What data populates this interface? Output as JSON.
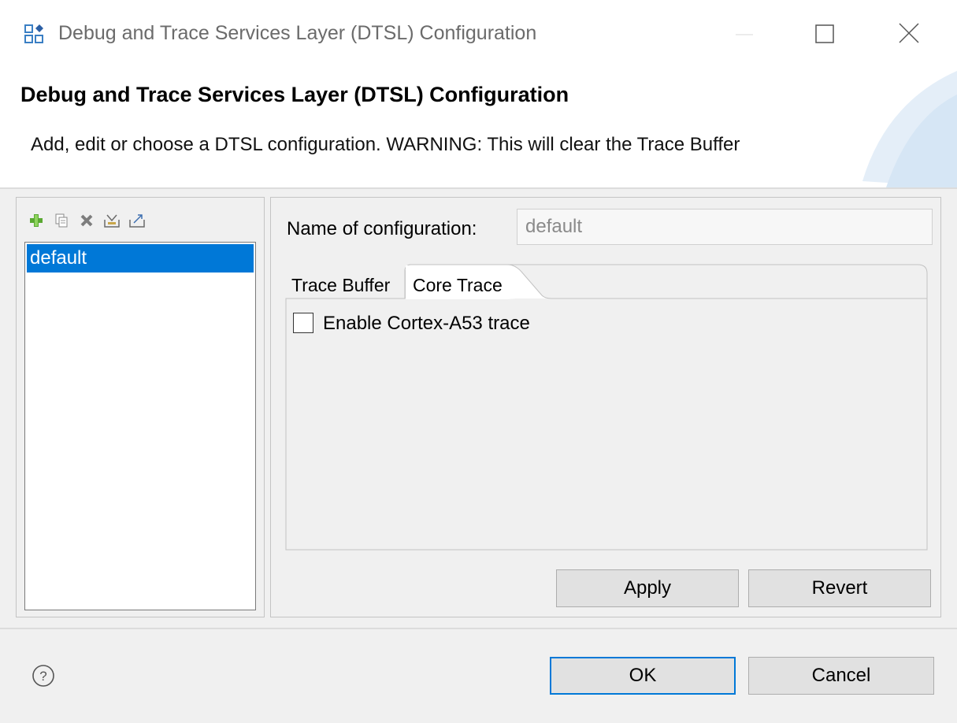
{
  "window": {
    "title": "Debug and Trace Services Layer (DTSL) Configuration",
    "icon": "dtsl-config-app-icon",
    "controls": [
      "minimize-icon",
      "maximize-icon",
      "close-icon"
    ]
  },
  "banner": {
    "title": "Debug and Trace Services Layer (DTSL) Configuration",
    "description": "Add, edit or choose a DTSL configuration.  WARNING: This will clear the Trace Buffer"
  },
  "toolbar": {
    "buttons": [
      {
        "icon": "add-icon"
      },
      {
        "icon": "copy-icon"
      },
      {
        "icon": "delete-icon"
      },
      {
        "icon": "import-icon"
      },
      {
        "icon": "export-icon"
      }
    ]
  },
  "config_list": {
    "items": [
      {
        "label": "default",
        "selected": true
      }
    ]
  },
  "config": {
    "name_label": "Name of configuration:",
    "name_value": "default"
  },
  "tabs": [
    {
      "label": "Trace Buffer",
      "active": false
    },
    {
      "label": "Core Trace",
      "active": true
    }
  ],
  "core_trace": {
    "enable_label": "Enable Cortex-A53 trace",
    "enabled": false
  },
  "buttons": {
    "apply": "Apply",
    "revert": "Revert",
    "ok": "OK",
    "cancel": "Cancel"
  },
  "colors": {
    "accent": "#0078d7",
    "background": "#f0f0f0",
    "selection_text": "#ffffff"
  }
}
